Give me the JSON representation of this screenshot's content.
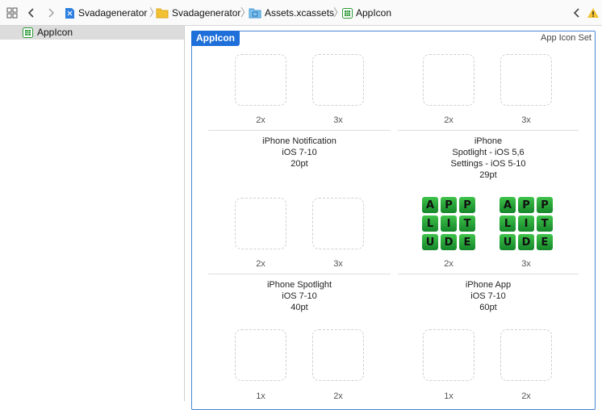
{
  "toolbar": {
    "breadcrumbs": [
      {
        "label": "Svadagenerator",
        "icon": "project-file-icon"
      },
      {
        "label": "Svadagenerator",
        "icon": "folder-icon"
      },
      {
        "label": "Assets.xcassets",
        "icon": "asset-catalog-icon"
      },
      {
        "label": "AppIcon",
        "icon": "app-icon-set-icon"
      }
    ]
  },
  "sidebar": {
    "items": [
      {
        "label": "AppIcon",
        "icon": "app-icon-set-icon"
      }
    ]
  },
  "asset": {
    "name": "AppIcon",
    "type_label": "App Icon Set"
  },
  "slots": [
    {
      "scales": [
        "2x",
        "3x"
      ],
      "lines": [
        "iPhone Notification",
        "iOS 7-10",
        "20pt"
      ],
      "filled": false
    },
    {
      "scales": [
        "2x",
        "3x"
      ],
      "lines": [
        "iPhone",
        "Spotlight - iOS 5,6",
        "Settings - iOS 5-10",
        "29pt"
      ],
      "filled": false
    },
    {
      "scales": [
        "2x",
        "3x"
      ],
      "lines": [
        "iPhone Spotlight",
        "iOS 7-10",
        "40pt"
      ],
      "filled": false
    },
    {
      "scales": [
        "2x",
        "3x"
      ],
      "lines": [
        "iPhone App",
        "iOS 7-10",
        "60pt"
      ],
      "filled": true
    },
    {
      "scales": [
        "1x",
        "2x"
      ],
      "lines": [],
      "filled": false
    },
    {
      "scales": [
        "1x",
        "2x"
      ],
      "lines": [],
      "filled": false
    }
  ],
  "icon_letters": [
    "A",
    "P",
    "P",
    "L",
    "I",
    "T",
    "U",
    "D",
    "E"
  ],
  "colors": {
    "accent": "#1e6fd9",
    "tile": "#2aa83a"
  }
}
